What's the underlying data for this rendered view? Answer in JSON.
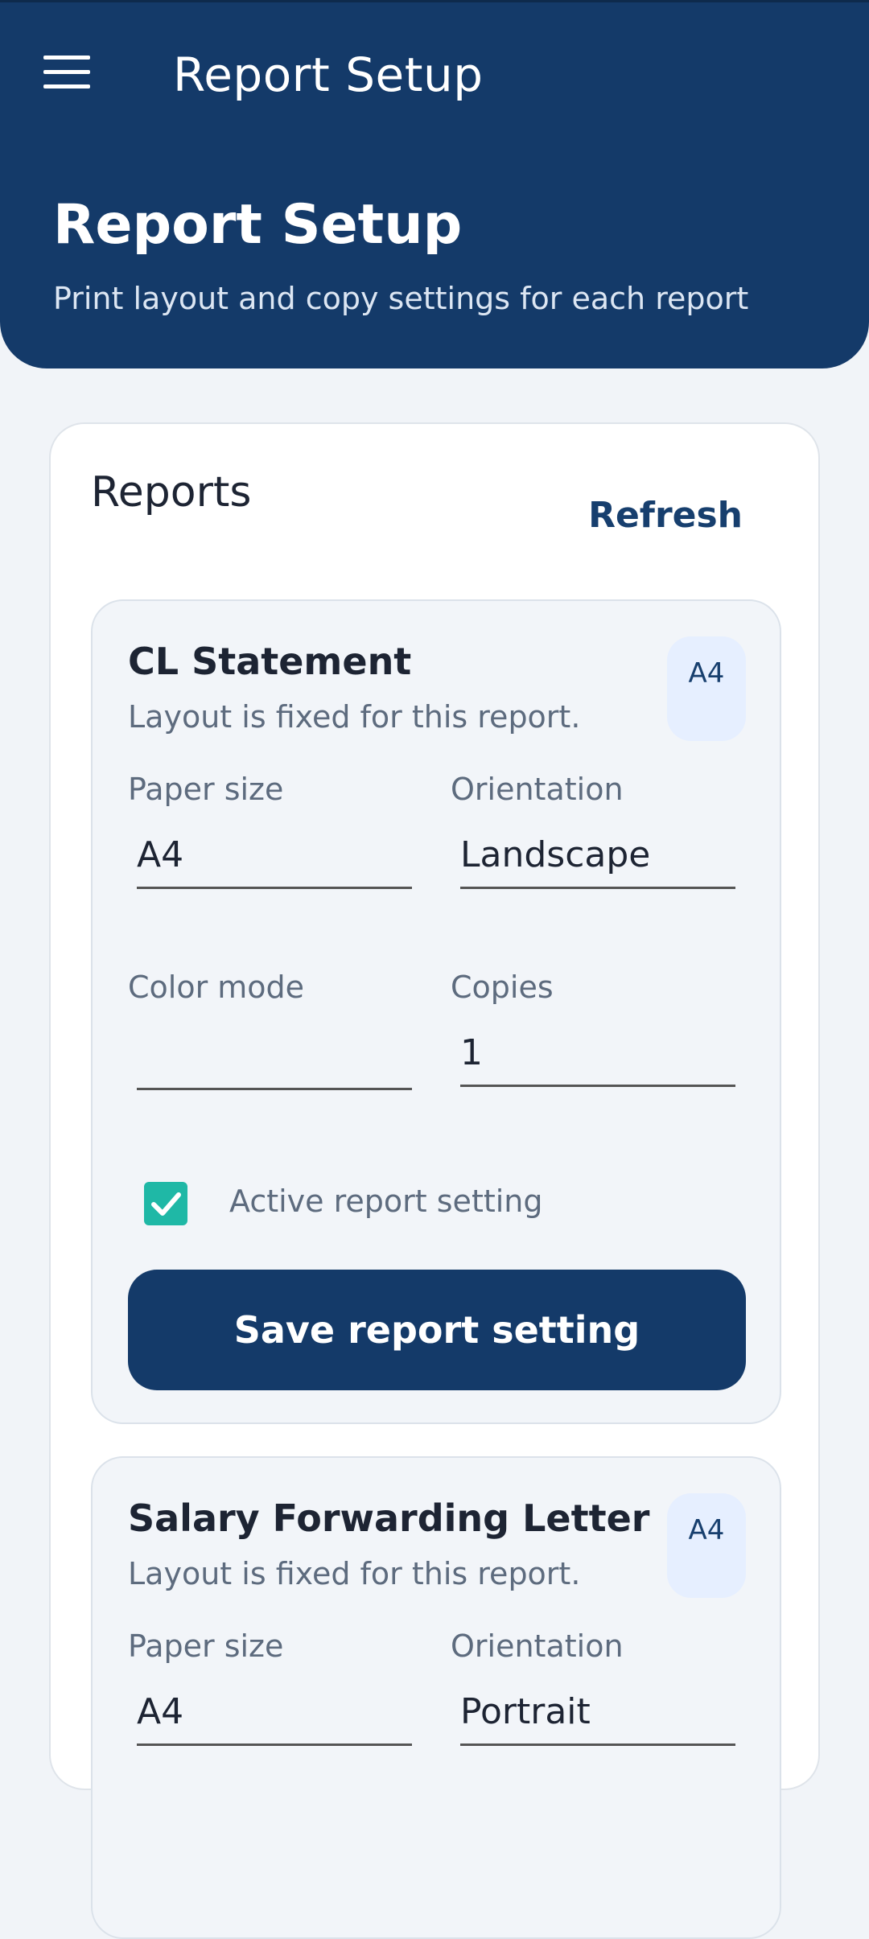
{
  "appbar": {
    "title": "Report Setup"
  },
  "hero": {
    "title": "Report Setup",
    "subtitle": "Print layout and copy settings for each report"
  },
  "reports_panel": {
    "title": "Reports",
    "refresh_label": "Refresh"
  },
  "reports": [
    {
      "name": "CL Statement",
      "note": "Layout is fixed for this report.",
      "badge": "A4",
      "paper_size_label": "Paper size",
      "paper_size": "A4",
      "orientation_label": "Orientation",
      "orientation": "Landscape",
      "color_mode_label": "Color mode",
      "color_mode": "",
      "copies_label": "Copies",
      "copies": "1",
      "active_label": "Active report setting",
      "active": true,
      "save_label": "Save report setting"
    },
    {
      "name": "Salary Forwarding Letter",
      "note": "Layout is fixed for this report.",
      "badge": "A4",
      "paper_size_label": "Paper size",
      "paper_size": "A4",
      "orientation_label": "Orientation",
      "orientation": "Portrait"
    }
  ],
  "colors": {
    "primary": "#143a69",
    "accent": "#1fb8a6",
    "background": "#f1f4f8"
  }
}
